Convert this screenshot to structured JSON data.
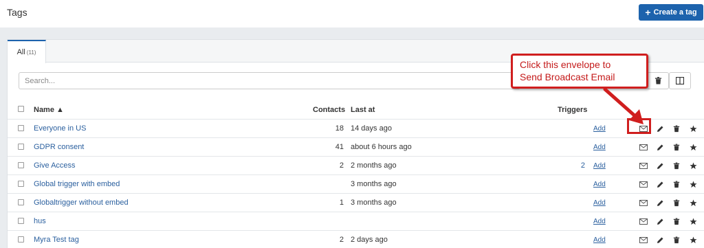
{
  "header": {
    "title": "Tags",
    "create_button_label": "Create a tag"
  },
  "tabs": [
    {
      "label": "All",
      "count": "(11)"
    }
  ],
  "search": {
    "placeholder": "Search..."
  },
  "table": {
    "columns": {
      "name": "Name ▲",
      "contacts": "Contacts",
      "last_at": "Last at",
      "triggers": "Triggers"
    },
    "rows": [
      {
        "name": "Everyone in US",
        "contacts": "18",
        "last_at": "14 days ago",
        "triggers": "",
        "add": "Add"
      },
      {
        "name": "GDPR consent",
        "contacts": "41",
        "last_at": "about 6 hours ago",
        "triggers": "",
        "add": "Add"
      },
      {
        "name": "Give Access",
        "contacts": "2",
        "last_at": "2 months ago",
        "triggers": "2",
        "add": "Add"
      },
      {
        "name": "Global trigger with embed",
        "contacts": "",
        "last_at": "3 months ago",
        "triggers": "",
        "add": "Add"
      },
      {
        "name": "Globaltrigger without embed",
        "contacts": "1",
        "last_at": "3 months ago",
        "triggers": "",
        "add": "Add"
      },
      {
        "name": "hus",
        "contacts": "",
        "last_at": "",
        "triggers": "",
        "add": "Add"
      },
      {
        "name": "Myra Test tag",
        "contacts": "2",
        "last_at": "2 days ago",
        "triggers": "",
        "add": "Add"
      }
    ]
  },
  "annotation": {
    "line1": "Click this envelope to",
    "line2": "Send Broadcast Email",
    "color": "#d01e1e"
  },
  "colors": {
    "primary": "#1d63ad",
    "link": "#2a5f9e"
  },
  "icons": [
    "plus-icon",
    "trash-icon",
    "columns-icon",
    "envelope-icon",
    "pencil-icon",
    "star-icon"
  ]
}
